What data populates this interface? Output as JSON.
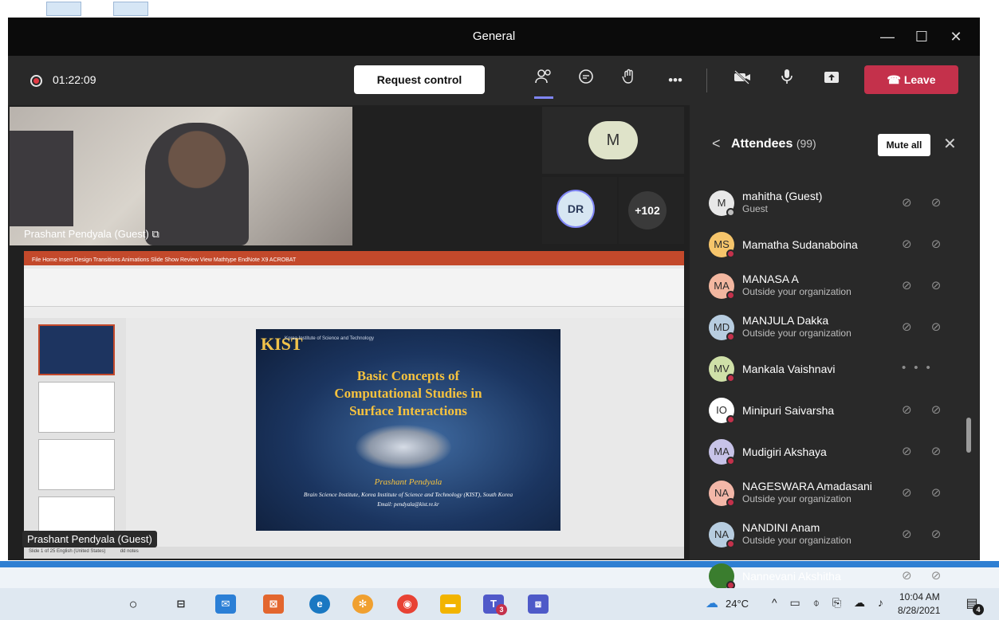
{
  "window": {
    "title": "General"
  },
  "window_controls": {
    "minimize": "—",
    "maximize": "☐",
    "close": "✕"
  },
  "toolbar": {
    "timer": "01:22:09",
    "request_control": "Request control",
    "more": "•••",
    "leave": "Leave",
    "leave_icon": "☎"
  },
  "stage": {
    "main_video_name": "Prashant Pendyala (Guest)",
    "tile_m": "M",
    "tile_dr": "DR",
    "tile_more": "+102",
    "shared_name": "Prashant Pendyala (Guest)"
  },
  "slide": {
    "logo": "KIST",
    "logo_sub": "Korea Institute of Science and Technology",
    "title_lines": [
      "Basic Concepts of",
      "Computational Studies in",
      "Surface Interactions"
    ],
    "author": "Prashant Pendyala",
    "affiliation": "Brain Science Institute, Korea Institute of Science and Technology (KIST), South Korea",
    "email": "Email: pendyala@kist.re.kr"
  },
  "ppt": {
    "tabs": "File   Home   Insert   Design   Transitions   Animations   Slide Show   Review   View   Mathtype   EndNote X9   ACROBAT",
    "status": "Slide 1 of 25   English (United States)",
    "notes": "dd notes"
  },
  "attendees": {
    "title": "Attendees",
    "count": "(99)",
    "mute_all": "Mute all",
    "list": [
      {
        "initials": "M",
        "name": "mahitha (Guest)",
        "sub": "Guest",
        "color": "#e8e8e8",
        "dot": "gray",
        "icons": "⊘ ⊘"
      },
      {
        "initials": "MS",
        "name": "Mamatha Sudanaboina",
        "sub": "",
        "color": "#f6c56b",
        "dot": "red",
        "icons": "⊘ ⊘"
      },
      {
        "initials": "MA",
        "name": "MANASA A",
        "sub": "Outside your organization",
        "color": "#f3b7a0",
        "dot": "red",
        "icons": "⊘ ⊘"
      },
      {
        "initials": "MD",
        "name": "MANJULA Dakka",
        "sub": "Outside your organization",
        "color": "#b7cde0",
        "dot": "red",
        "icons": "⊘ ⊘"
      },
      {
        "initials": "MV",
        "name": "Mankala Vaishnavi",
        "sub": "",
        "color": "#cfe0a8",
        "dot": "red",
        "icons": "•••"
      },
      {
        "initials": "IO",
        "name": "Minipuri Saivarsha",
        "sub": "",
        "color": "#ffffff",
        "dot": "red",
        "icons": "⊘ ⊘"
      },
      {
        "initials": "MA",
        "name": "Mudigiri Akshaya",
        "sub": "",
        "color": "#c7c3e8",
        "dot": "red",
        "icons": "⊘ ⊘"
      },
      {
        "initials": "NA",
        "name": "NAGESWARA Amadasani",
        "sub": "Outside your organization",
        "color": "#f3b7a8",
        "dot": "red",
        "icons": "⊘ ⊘"
      },
      {
        "initials": "NA",
        "name": "NANDINI Anam",
        "sub": "Outside your organization",
        "color": "#b7cde0",
        "dot": "red",
        "icons": "⊘ ⊘"
      },
      {
        "initials": "",
        "name": "Nannevani Akshitha",
        "sub": "",
        "color": "#3a7d2e",
        "dot": "red",
        "icons": "⊘ ⊘"
      }
    ]
  },
  "taskbar": {
    "weather": "24°C",
    "time": "10:04 AM",
    "date": "8/28/2021",
    "teams_badge": "3",
    "notify_badge": "4"
  }
}
